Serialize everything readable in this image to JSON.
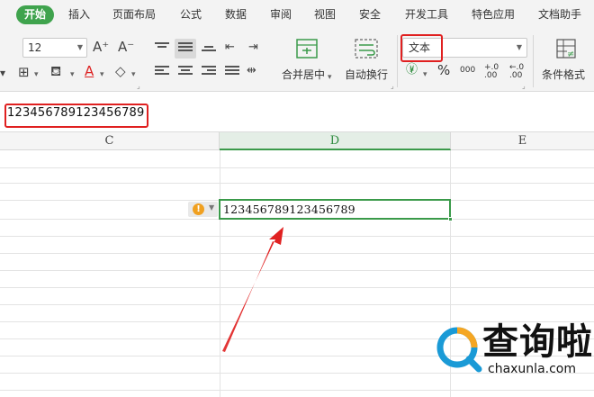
{
  "menu": {
    "tabs": [
      "开始",
      "插入",
      "页面布局",
      "公式",
      "数据",
      "审阅",
      "视图",
      "安全",
      "开发工具",
      "特色应用",
      "文档助手"
    ],
    "active": "开始"
  },
  "ribbon": {
    "font_size": "12",
    "grow_font": "A⁺",
    "shrink_font": "A⁻",
    "font_color_glyph": "A",
    "merge_center_label": "合并居中",
    "wrap_text_label": "自动换行",
    "number_format": "文本",
    "currency_symbol": "¥",
    "percent_symbol": "%",
    "thousands_symbol": "000",
    "increase_decimal": "+.0 .00",
    "decrease_decimal": "←.0 .00",
    "conditional_format_label": "条件格式"
  },
  "formula_bar": {
    "content": "123456789123456789"
  },
  "columns": [
    "C",
    "D",
    "E"
  ],
  "active_cell": {
    "column": "D",
    "value": "123456789123456789"
  },
  "annotations": {
    "highlights": [
      "number-format-select",
      "formula-bar-content",
      "active-cell"
    ],
    "color": "#e02020"
  },
  "watermark": {
    "title": "查询啦",
    "url": "chaxunla.com"
  },
  "colors": {
    "accent_green": "#3fa34d",
    "annotation_red": "#e02020",
    "warning_orange": "#f0a020"
  }
}
